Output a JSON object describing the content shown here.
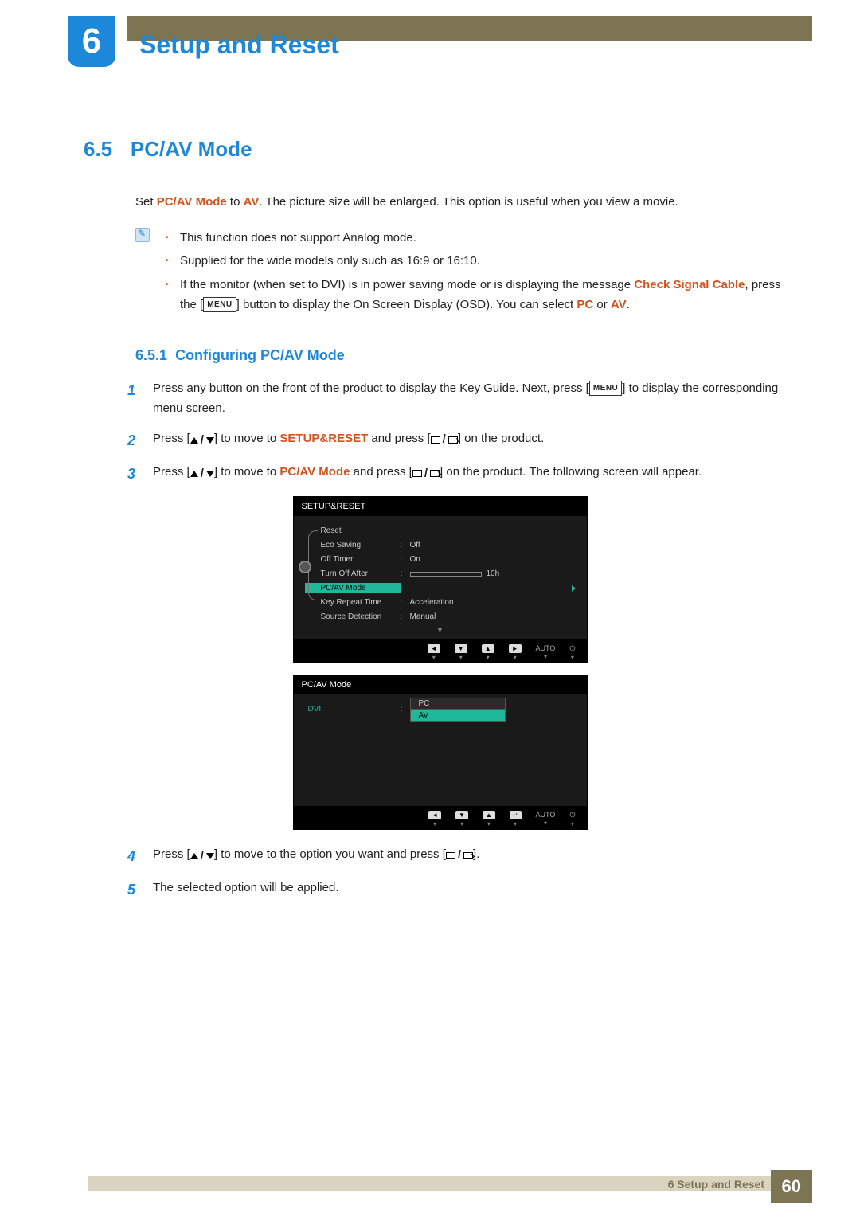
{
  "chapter": {
    "number": "6",
    "title": "Setup and Reset"
  },
  "section": {
    "number": "6.5",
    "title": "PC/AV Mode"
  },
  "intro": {
    "pre": "Set ",
    "hl1": "PC/AV Mode",
    "mid": " to ",
    "hl2": "AV",
    "post": ". The picture size will be enlarged. This option is useful when you view a movie."
  },
  "notes": {
    "n1": "This function does not support Analog mode.",
    "n2": "Supplied for the wide models only such as 16:9 or 16:10.",
    "n3_a": "If the monitor (when set to DVI) is in power saving mode or is displaying the message ",
    "n3_hl1": "Check Signal Cable",
    "n3_b": ", press the [",
    "n3_menu": "MENU",
    "n3_c": "] button to display the On Screen Display (OSD). You can select ",
    "n3_hl2": "PC",
    "n3_d": " or ",
    "n3_hl3": "AV",
    "n3_e": "."
  },
  "subsection": {
    "number": "6.5.1",
    "title": "Configuring PC/AV Mode"
  },
  "steps": {
    "s1_a": "Press any button on the front of the product to display the Key Guide. Next, press [",
    "s1_menu": "MENU",
    "s1_b": "] to display the corresponding menu screen.",
    "s2_a": "Press [",
    "s2_b": "] to move to ",
    "s2_hl": "SETUP&RESET",
    "s2_c": " and press [",
    "s2_d": "] on the product.",
    "s3_a": "Press [",
    "s3_b": "] to move to ",
    "s3_hl": "PC/AV Mode",
    "s3_c": " and press [",
    "s3_d": "] on the product. The following screen will appear.",
    "s4_a": "Press [",
    "s4_b": "] to move to the option you want and press [",
    "s4_c": "].",
    "s5": "The selected option will be applied."
  },
  "step_numbers": {
    "n1": "1",
    "n2": "2",
    "n3": "3",
    "n4": "4",
    "n5": "5"
  },
  "osd1": {
    "title": "SETUP&RESET",
    "rows": {
      "reset": "Reset",
      "eco": "Eco Saving",
      "eco_v": "Off",
      "timer": "Off Timer",
      "timer_v": "On",
      "turnoff": "Turn Off After",
      "turnoff_v": "10h",
      "pcav": "PC/AV Mode",
      "key": "Key Repeat Time",
      "key_v": "Acceleration",
      "src": "Source Detection",
      "src_v": "Manual"
    },
    "nav": {
      "auto": "AUTO"
    }
  },
  "osd2": {
    "title": "PC/AV Mode",
    "dvi": "DVI",
    "opt_pc": "PC",
    "opt_av": "AV",
    "nav": {
      "auto": "AUTO"
    }
  },
  "footer": {
    "label_prefix": "6 ",
    "label": "Setup and Reset",
    "page": "60"
  }
}
